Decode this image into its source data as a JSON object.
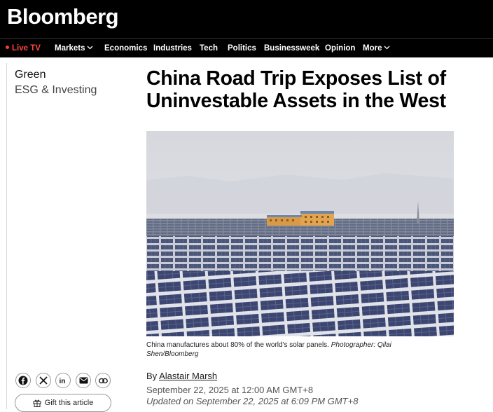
{
  "brand": {
    "logo": "Bloomberg"
  },
  "nav": {
    "live": "Live TV",
    "items": [
      "Markets",
      "Economics",
      "Industries",
      "Tech",
      "Politics",
      "Businessweek",
      "Opinion",
      "More"
    ]
  },
  "category": {
    "main": "Green",
    "sub": "ESG & Investing"
  },
  "article": {
    "headline": "China Road Trip Exposes List of Uninvestable Assets in the West",
    "caption": "China manufactures about 80% of the world's solar panels.",
    "credit": "Photographer: Qilai Shen/Bloomberg",
    "byline_prefix": "By",
    "author": "Alastair Marsh",
    "published": "September 22, 2025 at 12:00 AM GMT+8",
    "updated": "Updated on September 22, 2025 at 6:09 PM GMT+8"
  },
  "share": {
    "gift_label": "Gift this article"
  },
  "colors": {
    "topbar": "#000000",
    "live": "#ff453a"
  }
}
